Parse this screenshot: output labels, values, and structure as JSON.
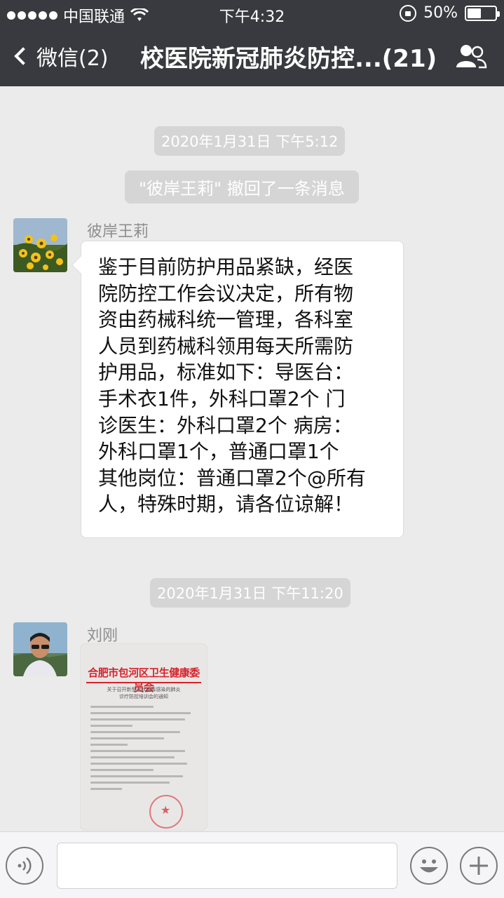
{
  "status_bar": {
    "carrier": "中国联通",
    "time": "下午4:32",
    "battery_percent_text": "50%",
    "battery_level": 0.5,
    "signal_icon": "signal-dots-icon",
    "wifi_icon": "wifi-icon",
    "orientation_lock_icon": "orientation-lock-icon"
  },
  "nav": {
    "back_label": "微信(2)",
    "title": "校医院新冠肺炎防控...(21)",
    "people_icon": "group-members-icon"
  },
  "messages": {
    "timestamp_1": "2020年1月31日 下午5:12",
    "recall_notice": "\"彼岸王莉\" 撤回了一条消息",
    "msg1": {
      "sender": "彼岸王莉",
      "avatar_icon": "flower-avatar",
      "text": "鉴于目前防护用品紧缺，经医\n院防控工作会议决定，所有物\n资由药械科统一管理，各科室\n人员到药械科领用每天所需防\n护用品，标准如下：导医台：\n手术衣1件，外科口罩2个    门\n诊医生：外科口罩2个  病房：\n外科口罩1个，普通口罩1个\n其他岗位：普通口罩2个@所有\n人，特殊时期，请各位谅解！"
    },
    "timestamp_2": "2020年1月31日 下午11:20",
    "msg2": {
      "sender": "刘刚",
      "avatar_icon": "person-avatar",
      "image": {
        "doc_header": "合肥市包河区卫生健康委员会",
        "doc_subtitle": "关于召开新型冠状病毒感染的肺炎\n诊疗防控培训会的通知"
      }
    }
  },
  "input_bar": {
    "voice_icon": "voice-icon",
    "emoji_icon": "emoji-icon",
    "add_icon": "plus-icon",
    "input_value": ""
  },
  "colors": {
    "nav_bg": "#393a3f",
    "chat_bg": "#ebebeb",
    "pill_bg": "#d5d5d5",
    "doc_red": "#d6232b"
  }
}
